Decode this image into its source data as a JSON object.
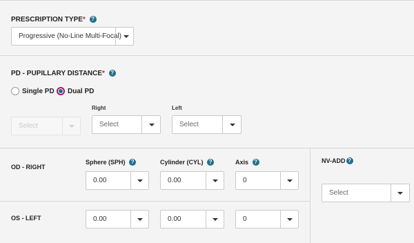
{
  "prescription_type": {
    "title": "PRESCRIPTION TYPE",
    "required_mark": "*",
    "help": "?",
    "selected": "Progressive (No-Line Multi-Focal)"
  },
  "pd": {
    "title": "PD - PUPILLARY DISTANCE",
    "required_mark": "*",
    "help": "?",
    "options": [
      {
        "label": "Single PD",
        "checked": false
      },
      {
        "label": "Dual PD",
        "checked": true
      }
    ],
    "single_select_placeholder": "Select",
    "right_label": "Right",
    "right_placeholder": "Select",
    "left_label": "Left",
    "left_placeholder": "Select"
  },
  "grid": {
    "headers": {
      "sphere": "Sphere (SPH)",
      "cylinder": "Cylinder (CYL)",
      "axis": "Axis",
      "help": "?"
    },
    "od": {
      "label": "OD - RIGHT",
      "sphere": "0.00",
      "cylinder": "0.00",
      "axis": "0"
    },
    "os": {
      "label": "OS - LEFT",
      "sphere": "0.00",
      "cylinder": "0.00",
      "axis": "0"
    },
    "nv_add": {
      "label": "NV-ADD",
      "help": "?",
      "placeholder": "Select"
    }
  },
  "colors": {
    "accent": "#1a6f8e",
    "radio_ring": "#a0186a",
    "required": "#c0262d"
  }
}
